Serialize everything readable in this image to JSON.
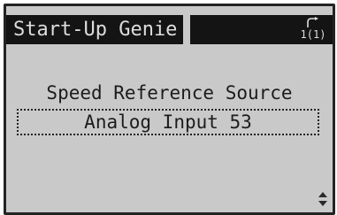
{
  "header": {
    "title": "Start-Up Genie",
    "menu_index": "1(1)"
  },
  "parameter": {
    "label": "Speed Reference Source",
    "value": "Analog Input 53"
  },
  "icons": {
    "menu": "return-arrow-icon",
    "scroll": "up-down-arrows-icon"
  },
  "colors": {
    "display_background": "#c9c9c9",
    "title_background": "#141414",
    "title_text": "#dddddd",
    "body_text": "#1c1c1c"
  }
}
